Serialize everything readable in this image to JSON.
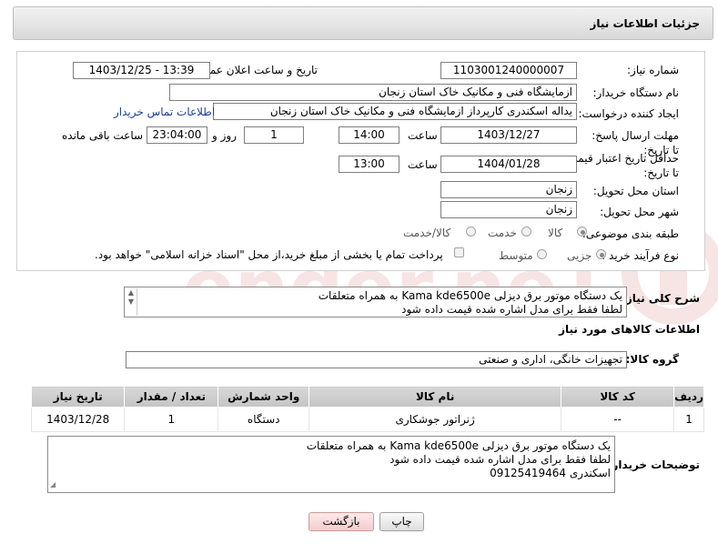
{
  "header": {
    "title": "جزئیات اطلاعات نیاز"
  },
  "form": {
    "need_number_label": "شماره نیاز:",
    "need_number": "1103001240000007",
    "announce_label": "تاریخ و ساعت اعلان عمومی:",
    "announce_value": "1403/12/25 - 13:39",
    "buyer_org_label": "نام دستگاه خریدار:",
    "buyer_org": "ازمایشگاه فنی و مکانیک خاک استان زنجان",
    "creator_label": "ایجاد کننده درخواست:",
    "creator": "یداله اسکندری کارپرداز ازمایشگاه فنی و مکانیک خاک استان زنجان",
    "contact_link": "اطلاعات تماس خریدار",
    "deadline_label": "مهلت ارسال پاسخ: تا تاریخ:",
    "deadline_date": "1403/12/27",
    "time_label": "ساعت",
    "deadline_time": "14:00",
    "days_value": "1",
    "days_and_label": "روز و",
    "remaining_time": "23:04:00",
    "remaining_label": "ساعت باقی مانده",
    "validity_label": "حداقل تاریخ اعتبار قیمت: تا تاریخ:",
    "validity_date": "1404/01/28",
    "validity_time": "13:00",
    "province_label": "استان محل تحویل:",
    "province": "زنجان",
    "city_label": "شهر محل تحویل:",
    "city": "زنجان",
    "category_label": "طبقه بندی موضوعی:",
    "category_options": [
      "کالا",
      "خدمت",
      "کالا/خدمت"
    ],
    "process_label": "نوع فرآیند خرید :",
    "process_options": [
      "جزیی",
      "متوسط"
    ],
    "payment_note": "پرداخت تمام یا بخشی از مبلغ خرید،از محل \"اسناد خزانه اسلامی\" خواهد بود."
  },
  "description": {
    "label": "شرح کلی نیاز:",
    "lines": [
      "یک دستگاه موتور برق دیزلی Kama kde6500e به همراه متعلقات",
      "لطفا فقط برای مدل اشاره شده قیمت داده شود"
    ]
  },
  "goods_section_title": "اطلاعات کالاهای مورد نیاز",
  "goods_group": {
    "label": "گروه کالا:",
    "value": "تجهیزات خانگی، اداری و صنعتی"
  },
  "table": {
    "headers": [
      "ردیف",
      "کد کالا",
      "نام کالا",
      "واحد شمارش",
      "تعداد / مقدار",
      "تاریخ نیاز"
    ],
    "rows": [
      [
        "1",
        "--",
        "ژنراتور جوشکاری",
        "دستگاه",
        "1",
        "1403/12/28"
      ]
    ]
  },
  "buyer_notes": {
    "label": "توضیحات خریدار:",
    "lines": [
      "یک دستگاه موتور برق دیزلی Kama kde6500e به همراه متعلقات",
      "لطفا فقط برای مدل اشاره شده قیمت داده شود",
      "اسکندری 09125419464"
    ]
  },
  "buttons": {
    "print": "چاپ",
    "back": "بازگشت"
  },
  "watermark": {
    "text": "AriaTender.neT"
  }
}
